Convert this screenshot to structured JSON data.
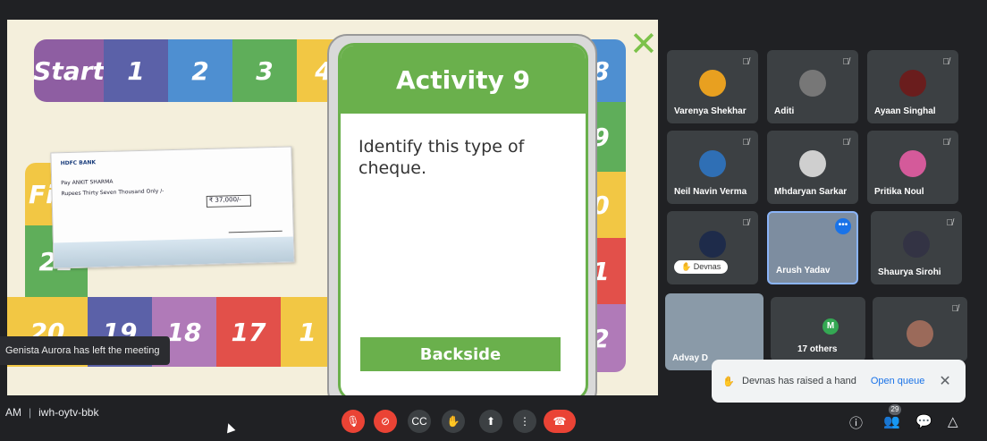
{
  "board": {
    "top_row": [
      "Start",
      "1",
      "2",
      "3",
      "4"
    ],
    "right_col": [
      "8",
      "9",
      "0",
      "1",
      "2"
    ],
    "bottom_row": [
      "20",
      "19",
      "18",
      "17",
      "1"
    ],
    "left_partial": [
      "Fi",
      "21"
    ],
    "close_icon": "close-icon"
  },
  "cheque": {
    "bank": "HDFC BANK",
    "pay": "Pay  ANKIT SHARMA",
    "rupees": "Rupees  Thirty Seven Thousand Only /-",
    "amount": "₹ 37,000/-"
  },
  "card": {
    "title": "Activity 9",
    "question": "Identify this type of cheque.",
    "button": "Backside"
  },
  "left_toast": "Genista Aurora has left the meeting",
  "participants": [
    {
      "name": "Varenya Shekhar"
    },
    {
      "name": "Aditi"
    },
    {
      "name": "Ayaan Singhal"
    },
    {
      "name": "Neil Navin Verma"
    },
    {
      "name": "Mhdaryan Sarkar"
    },
    {
      "name": "Pritika Noul"
    },
    {
      "name": "Devnas"
    },
    {
      "name": "Arush Yadav"
    },
    {
      "name": "Shaurya Sirohi"
    },
    {
      "name": "Advay D"
    },
    {
      "name": "17 others",
      "badge": "M"
    },
    {
      "name": ""
    }
  ],
  "notification": {
    "text": "Devnas has raised a hand",
    "link": "Open queue"
  },
  "meeting": {
    "time": "AM",
    "code": "iwh-oytv-bbk"
  },
  "people_count": "29",
  "colors": {
    "green": "#6ab04c",
    "red": "#ea4335",
    "blue": "#1a73e8"
  }
}
